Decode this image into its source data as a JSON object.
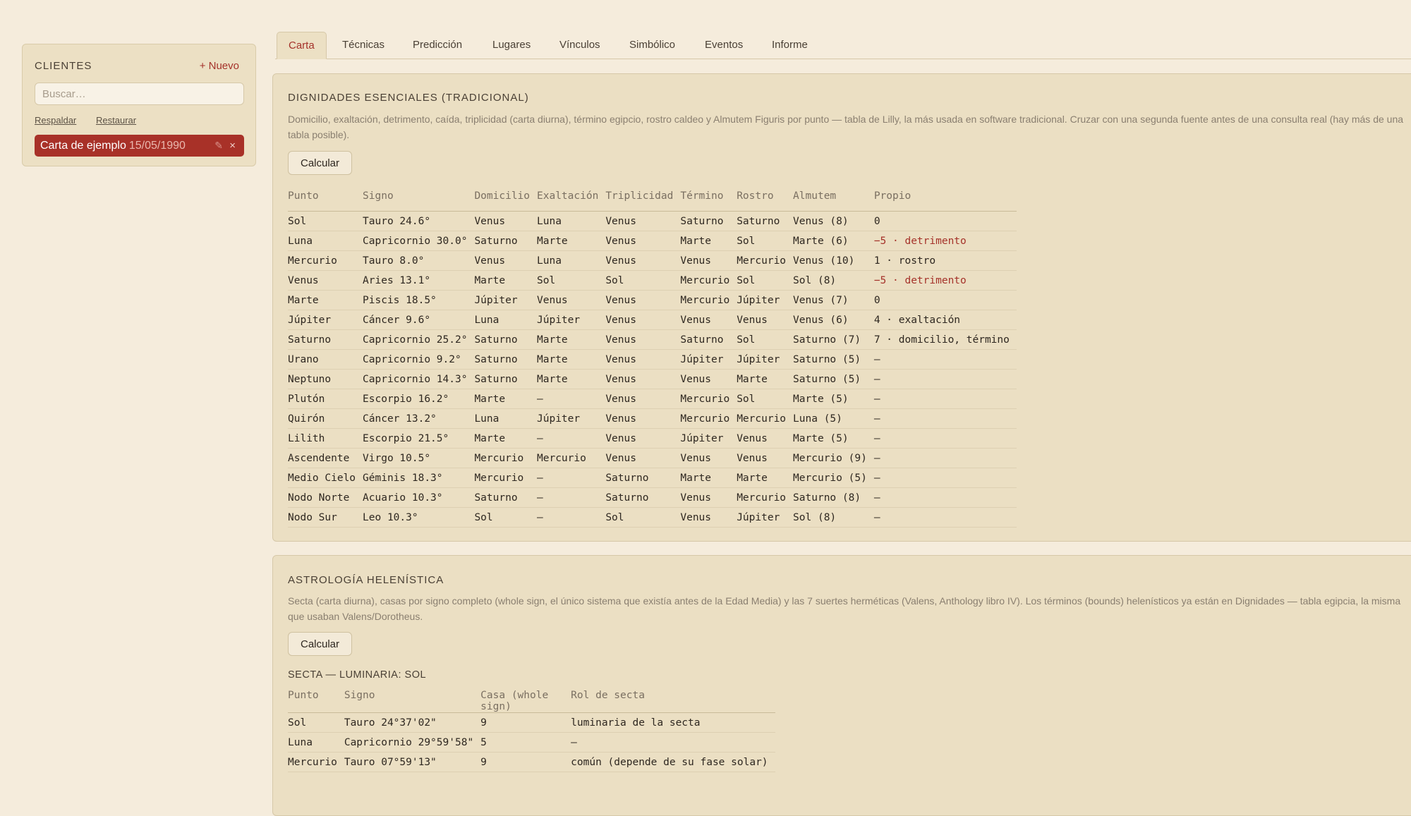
{
  "sidebar": {
    "title": "CLIENTES",
    "new_label": "+ Nuevo",
    "search_placeholder": "Buscar…",
    "backup_label": "Respaldar",
    "restore_label": "Restaurar",
    "client": {
      "name": "Carta de ejemplo",
      "date": "15/05/1990",
      "edit_icon": "pencil-icon",
      "delete_icon": "close-icon"
    }
  },
  "tabs": [
    {
      "label": "Carta",
      "active": true
    },
    {
      "label": "Técnicas"
    },
    {
      "label": "Predicción"
    },
    {
      "label": "Lugares"
    },
    {
      "label": "Vínculos"
    },
    {
      "label": "Simbólico"
    },
    {
      "label": "Eventos"
    },
    {
      "label": "Informe"
    }
  ],
  "dignities": {
    "title": "DIGNIDADES ESENCIALES (TRADICIONAL)",
    "description": "Domicilio, exaltación, detrimento, caída, triplicidad (carta diurna), término egipcio, rostro caldeo y Almutem Figuris por punto — tabla de Lilly, la más usada en software tradicional. Cruzar con una segunda fuente antes de una consulta real (hay más de una tabla posible).",
    "button": "Calcular",
    "headers": [
      "Punto",
      "Signo",
      "Domicilio",
      "Exaltación",
      "Triplicidad",
      "Término",
      "Rostro",
      "Almutem",
      "Propio"
    ],
    "rows": [
      [
        "Sol",
        "Tauro 24.6°",
        "Venus",
        "Luna",
        "Venus",
        "Saturno",
        "Saturno",
        "Venus (8)",
        "0"
      ],
      [
        "Luna",
        "Capricornio 30.0°",
        "Saturno",
        "Marte",
        "Venus",
        "Marte",
        "Sol",
        "Marte (6)",
        "−5 · detrimento"
      ],
      [
        "Mercurio",
        "Tauro 8.0°",
        "Venus",
        "Luna",
        "Venus",
        "Venus",
        "Mercurio",
        "Venus (10)",
        "1 · rostro"
      ],
      [
        "Venus",
        "Aries 13.1°",
        "Marte",
        "Sol",
        "Sol",
        "Mercurio",
        "Sol",
        "Sol (8)",
        "−5 · detrimento"
      ],
      [
        "Marte",
        "Piscis 18.5°",
        "Júpiter",
        "Venus",
        "Venus",
        "Mercurio",
        "Júpiter",
        "Venus (7)",
        "0"
      ],
      [
        "Júpiter",
        "Cáncer 9.6°",
        "Luna",
        "Júpiter",
        "Venus",
        "Venus",
        "Venus",
        "Venus (6)",
        "4 · exaltación"
      ],
      [
        "Saturno",
        "Capricornio 25.2°",
        "Saturno",
        "Marte",
        "Venus",
        "Saturno",
        "Sol",
        "Saturno (7)",
        "7 · domicilio, término"
      ],
      [
        "Urano",
        "Capricornio 9.2°",
        "Saturno",
        "Marte",
        "Venus",
        "Júpiter",
        "Júpiter",
        "Saturno (5)",
        "—"
      ],
      [
        "Neptuno",
        "Capricornio 14.3°",
        "Saturno",
        "Marte",
        "Venus",
        "Venus",
        "Marte",
        "Saturno (5)",
        "—"
      ],
      [
        "Plutón",
        "Escorpio 16.2°",
        "Marte",
        "—",
        "Venus",
        "Mercurio",
        "Sol",
        "Marte (5)",
        "—"
      ],
      [
        "Quirón",
        "Cáncer 13.2°",
        "Luna",
        "Júpiter",
        "Venus",
        "Mercurio",
        "Mercurio",
        "Luna (5)",
        "—"
      ],
      [
        "Lilith",
        "Escorpio 21.5°",
        "Marte",
        "—",
        "Venus",
        "Júpiter",
        "Venus",
        "Marte (5)",
        "—"
      ],
      [
        "Ascendente",
        "Virgo 10.5°",
        "Mercurio",
        "Mercurio",
        "Venus",
        "Venus",
        "Venus",
        "Mercurio (9)",
        "—"
      ],
      [
        "Medio Cielo",
        "Géminis 18.3°",
        "Mercurio",
        "—",
        "Saturno",
        "Marte",
        "Marte",
        "Mercurio (5)",
        "—"
      ],
      [
        "Nodo Norte",
        "Acuario 10.3°",
        "Saturno",
        "—",
        "Saturno",
        "Venus",
        "Mercurio",
        "Saturno (8)",
        "—"
      ],
      [
        "Nodo Sur",
        "Leo 10.3°",
        "Sol",
        "—",
        "Sol",
        "Venus",
        "Júpiter",
        "Sol (8)",
        "—"
      ]
    ]
  },
  "hellenistic": {
    "title": "ASTROLOGÍA HELENÍSTICA",
    "description": "Secta (carta diurna), casas por signo completo (whole sign, el único sistema que existía antes de la Edad Media) y las 7 suertes herméticas (Valens, Anthology libro IV). Los términos (bounds) helenísticos ya están en Dignidades — tabla egipcia, la misma que usaban Valens/Dorotheus.",
    "button": "Calcular",
    "sect_title": "SECTA — LUMINARIA: SOL",
    "headers": [
      "Punto",
      "Signo",
      "Casa (whole sign)",
      "Rol de secta"
    ],
    "rows": [
      [
        "Sol",
        "Tauro 24°37'02\"",
        "9",
        "luminaria de la secta"
      ],
      [
        "Luna",
        "Capricornio 29°59'58\"",
        "5",
        "—"
      ],
      [
        "Mercurio",
        "Tauro 07°59'13\"",
        "9",
        "común (depende de su fase solar)"
      ]
    ]
  }
}
